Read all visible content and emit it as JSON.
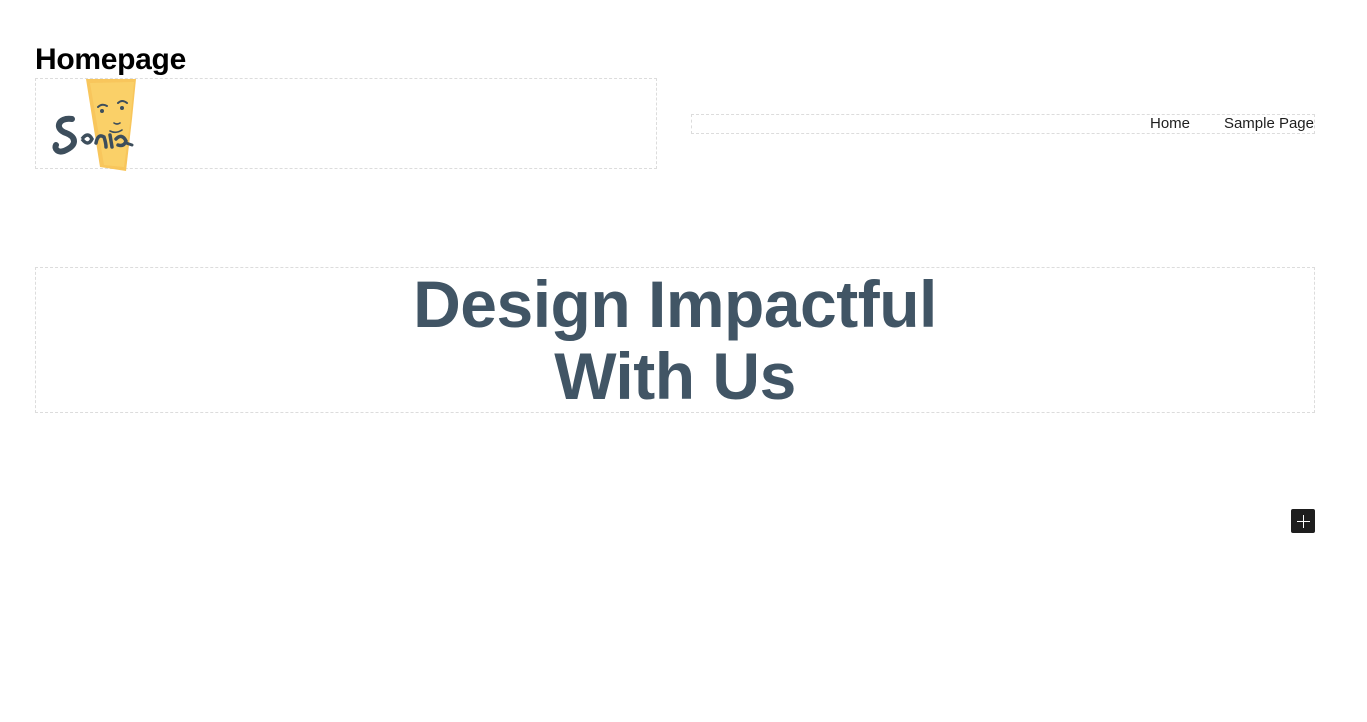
{
  "page": {
    "title": "Homepage"
  },
  "header": {
    "logo": {
      "icon": "site-logo",
      "text": "Sonia",
      "colors": {
        "brush": "#f7c04a",
        "ink": "#3d4e5c"
      }
    },
    "nav": {
      "items": [
        {
          "label": "Home"
        },
        {
          "label": "Sample Page"
        }
      ]
    }
  },
  "hero": {
    "heading_line1": "Design Impactful",
    "heading_line2": "With Us",
    "color": "#415565"
  },
  "inserter": {
    "icon": "plus-icon"
  }
}
